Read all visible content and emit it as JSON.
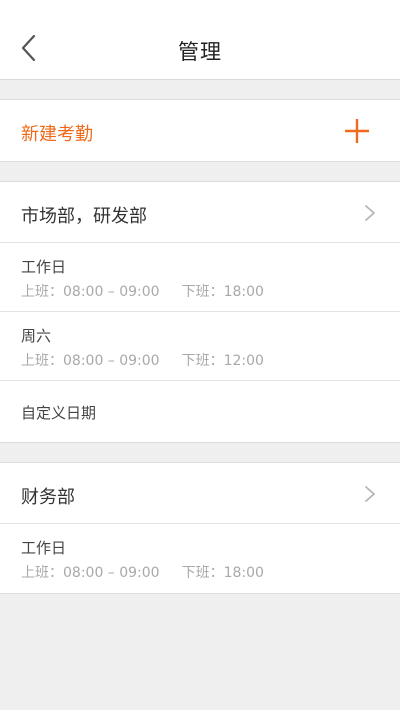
{
  "nav": {
    "title": "管理",
    "back_icon": "chevron-left-icon"
  },
  "new_attendance": {
    "label": "新建考勤",
    "icon": "plus-icon",
    "accent_color": "#f06a1c"
  },
  "groups": [
    {
      "departments": "市场部，研发部",
      "rows": [
        {
          "day": "工作日",
          "on_duty": "上班：08:00 – 09:00",
          "off_duty": "下班：18:00"
        },
        {
          "day": "周六",
          "on_duty": "上班：08:00 – 09:00",
          "off_duty": "下班：12:00"
        }
      ],
      "custom_label": "自定义日期"
    },
    {
      "departments": "财务部",
      "rows": [
        {
          "day": "工作日",
          "on_duty": "上班：08:00 – 09:00",
          "off_duty": "下班：18:00"
        }
      ]
    }
  ]
}
